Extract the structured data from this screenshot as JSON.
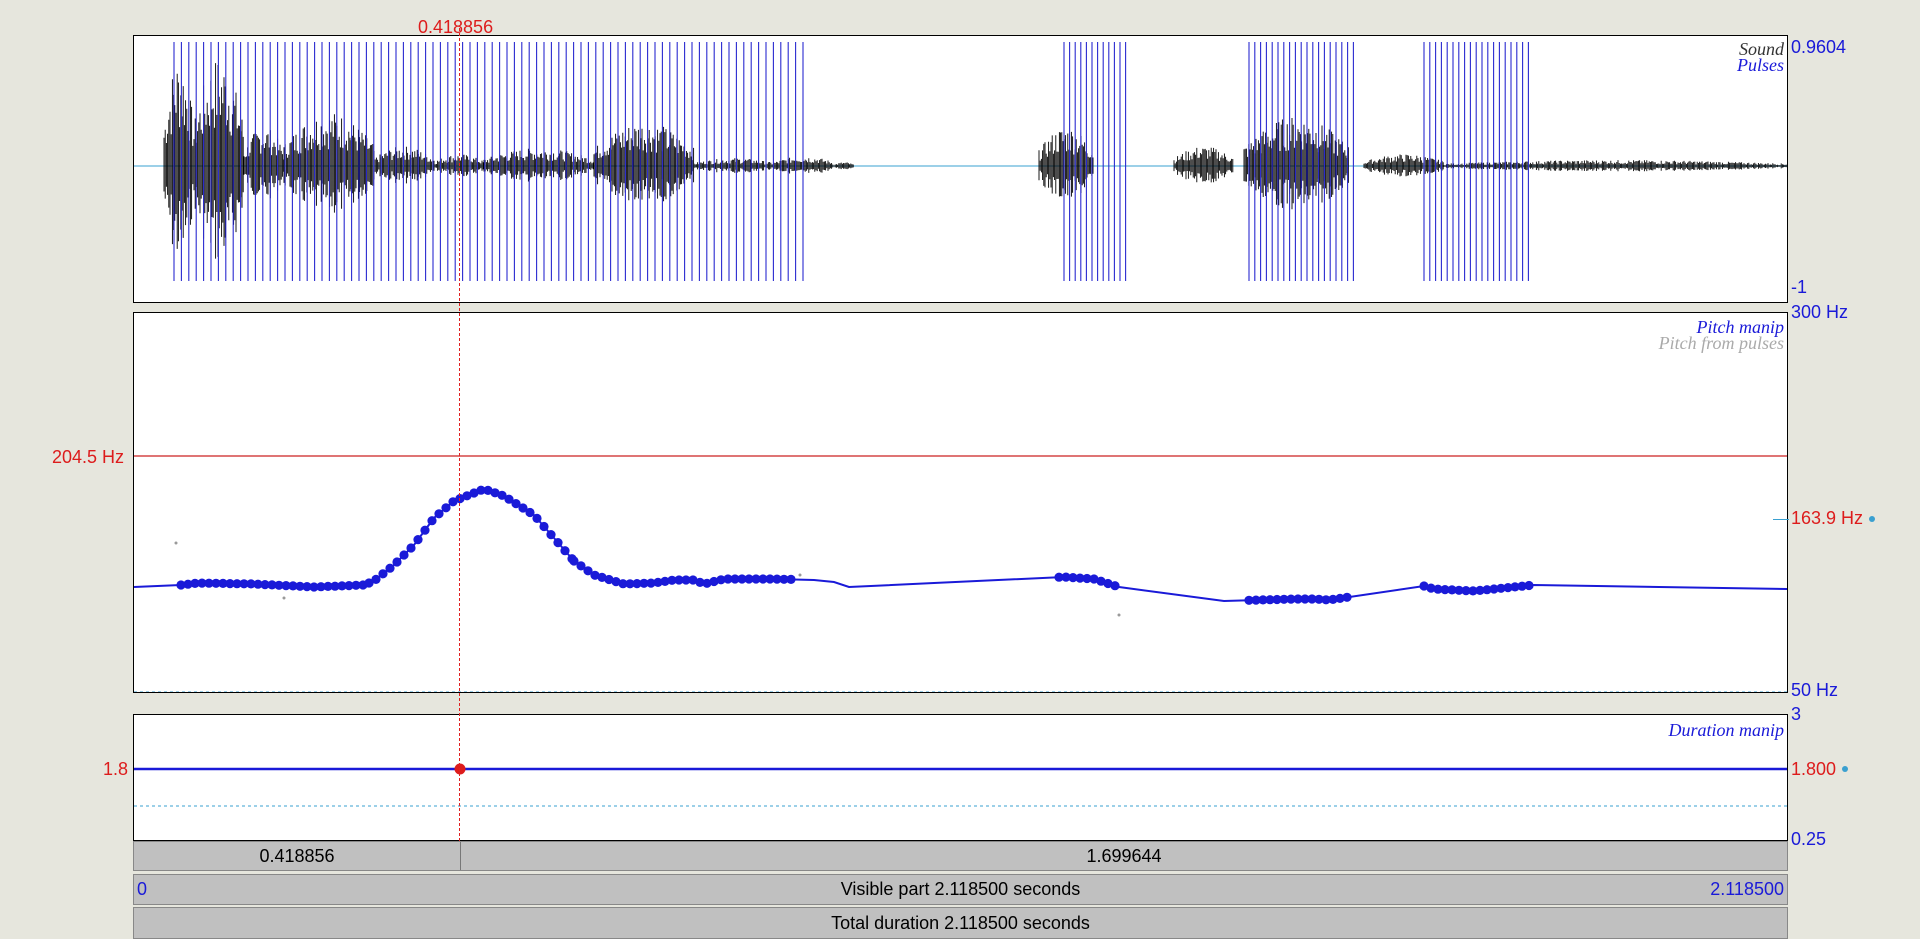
{
  "cursor": {
    "time_label": "0.418856"
  },
  "sound": {
    "tier_label_sound": "Sound",
    "tier_label_pulses": "Pulses",
    "ymax_label": "0.9604",
    "ymin_label": "-1"
  },
  "pitch": {
    "tier_label_manip": "Pitch manip",
    "tier_label_pulses": "Pitch from pulses",
    "top_label": "300 Hz",
    "bottom_label": "50 Hz",
    "cursor_value_label": "204.5 Hz",
    "mean_label": "163.9 Hz"
  },
  "duration": {
    "tier_label": "Duration manip",
    "top_label": "3",
    "bottom_label": "0.25",
    "left_value_label": "1.8",
    "right_value_label": "1.800"
  },
  "selection_bar": {
    "left_segment": "0.418856",
    "right_segment": "1.699644"
  },
  "visible_bar": {
    "start": "0",
    "text": "Visible part 2.118500 seconds",
    "end": "2.118500"
  },
  "total_bar": {
    "text": "Total duration 2.118500 seconds"
  },
  "colors": {
    "pitch_manip": "#1a1ad8",
    "cursor": "#dd1c1c",
    "pulses": "#2a2ad0",
    "waveform": "#000000"
  }
}
